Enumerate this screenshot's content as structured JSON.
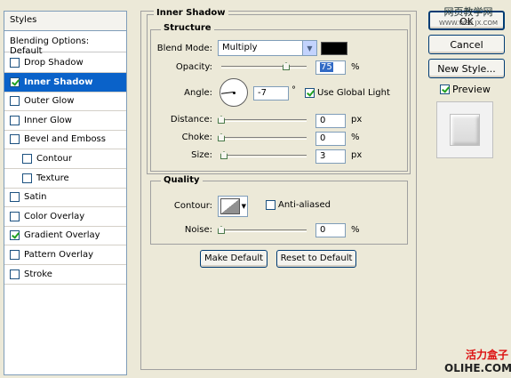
{
  "styles_panel": {
    "header": "Styles",
    "blending_options": "Blending Options: Default",
    "items": [
      {
        "label": "Drop Shadow",
        "checked": false,
        "active": false,
        "indent": false
      },
      {
        "label": "Inner Shadow",
        "checked": true,
        "active": true,
        "indent": false
      },
      {
        "label": "Outer Glow",
        "checked": false,
        "active": false,
        "indent": false
      },
      {
        "label": "Inner Glow",
        "checked": false,
        "active": false,
        "indent": false
      },
      {
        "label": "Bevel and Emboss",
        "checked": false,
        "active": false,
        "indent": false
      },
      {
        "label": "Contour",
        "checked": false,
        "active": false,
        "indent": true
      },
      {
        "label": "Texture",
        "checked": false,
        "active": false,
        "indent": true
      },
      {
        "label": "Satin",
        "checked": false,
        "active": false,
        "indent": false
      },
      {
        "label": "Color Overlay",
        "checked": false,
        "active": false,
        "indent": false
      },
      {
        "label": "Gradient Overlay",
        "checked": true,
        "active": false,
        "indent": false
      },
      {
        "label": "Pattern Overlay",
        "checked": false,
        "active": false,
        "indent": false
      },
      {
        "label": "Stroke",
        "checked": false,
        "active": false,
        "indent": false
      }
    ]
  },
  "inner_shadow": {
    "title": "Inner Shadow",
    "structure": {
      "title": "Structure",
      "blend_mode_label": "Blend Mode:",
      "blend_mode_value": "Multiply",
      "shadow_color": "#000000",
      "opacity_label": "Opacity:",
      "opacity_value": "75",
      "opacity_fraction": 0.75,
      "percent_unit": "%",
      "angle_label": "Angle:",
      "angle_value": "-7",
      "degree_unit": "°",
      "use_global_light_label": "Use Global Light",
      "use_global_light_checked": true,
      "distance_label": "Distance:",
      "distance_value": "0",
      "px_unit": "px",
      "choke_label": "Choke:",
      "choke_value": "0",
      "size_label": "Size:",
      "size_value": "3"
    },
    "quality": {
      "title": "Quality",
      "contour_label": "Contour:",
      "anti_aliased_label": "Anti-aliased",
      "anti_aliased_checked": false,
      "noise_label": "Noise:",
      "noise_value": "0"
    },
    "make_default_label": "Make Default",
    "reset_default_label": "Reset to Default"
  },
  "right_column": {
    "ok_label": "OK",
    "cancel_label": "Cancel",
    "new_style_label": "New Style...",
    "preview_label": "Preview",
    "preview_checked": true
  },
  "watermarks": {
    "top_cn": "网页教学网",
    "top_url": "WWW.WEB JX.COM",
    "bottom_cn": "活力盒子",
    "bottom_en": "OLIHE.COM"
  },
  "colors": {
    "accent": "#0a62c9",
    "dialog_bg": "#ece9d8",
    "check_green": "#21a121"
  }
}
